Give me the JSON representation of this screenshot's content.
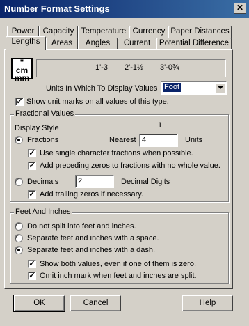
{
  "window": {
    "title": "Number Format Settings",
    "close_glyph": "✕"
  },
  "tabs_row1": [
    "Power",
    "Capacity",
    "Temperature",
    "Currency",
    "Paper Distances"
  ],
  "tabs_row2": [
    "Lengths",
    "Areas",
    "Angles",
    "Current",
    "Potential Difference"
  ],
  "active_tab": "Lengths",
  "header": {
    "icon_label_top": "\"",
    "icon_label_mid": "cm",
    "icon_label_bot": "mm",
    "samples": [
      "1'-3",
      "2'-1½",
      "3'-0¾"
    ],
    "units_label": "Units In Which To Display Values",
    "units_value": "Foot",
    "show_unit_marks_label": "Show unit marks on all values of this type."
  },
  "fractional": {
    "group_label": "Fractional Values",
    "display_style_label": "Display Style",
    "one_label": "1",
    "fractions_label": "Fractions",
    "nearest_label": "Nearest",
    "nearest_value": "4",
    "units_suffix": "Units",
    "single_char_label": "Use single character fractions when possible.",
    "preceding_zeros_label": "Add preceding zeros to fractions with no whole value.",
    "decimals_label": "Decimals",
    "decimal_digits_value": "2",
    "decimal_digits_label": "Decimal Digits",
    "trailing_zeros_label": "Add trailing zeros if necessary."
  },
  "feet_inches": {
    "group_label": "Feet And Inches",
    "no_split_label": "Do not split into feet and inches.",
    "space_label": "Separate feet and inches with a space.",
    "dash_label": "Separate feet and inches with a dash.",
    "show_both_label": "Show both values, even if one of them is zero.",
    "omit_inch_label": "Omit inch mark when feet and inches are split."
  },
  "buttons": {
    "ok": "OK",
    "cancel": "Cancel",
    "help": "Help"
  },
  "state": {
    "show_unit_marks": true,
    "style": "fractions",
    "single_char": true,
    "preceding_zeros": true,
    "trailing_zeros": true,
    "split_mode": "dash",
    "show_both": true,
    "omit_inch": true
  },
  "colors": {
    "title_start": "#0a246a",
    "title_end": "#3a6ea5",
    "face": "#d4d0c8",
    "selection": "#0a246a"
  }
}
